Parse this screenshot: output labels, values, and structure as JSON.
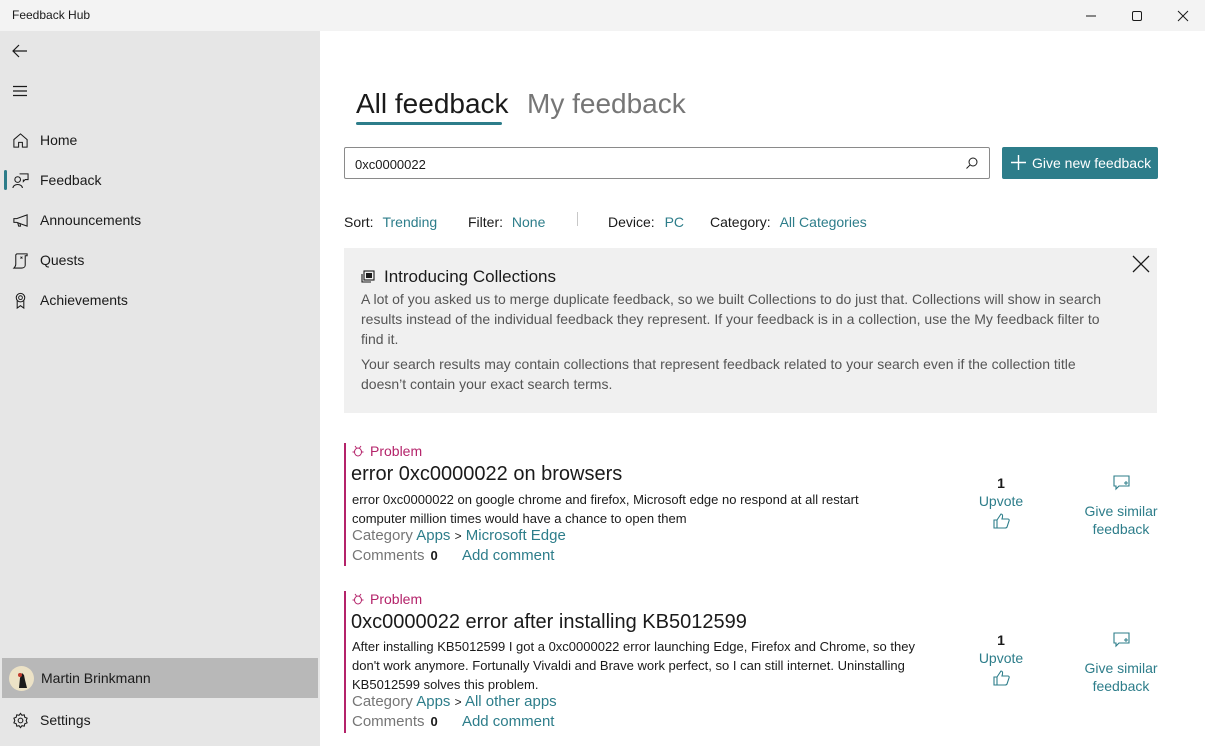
{
  "window": {
    "title": "Feedback Hub",
    "controls": [
      "minimize",
      "maximize",
      "close"
    ]
  },
  "sidebar": {
    "back_icon": "back-arrow-icon",
    "menu_icon": "hamburger-icon",
    "items": [
      {
        "label": "Home",
        "icon": "home-icon",
        "selected": false
      },
      {
        "label": "Feedback",
        "icon": "feedback-icon",
        "selected": true
      },
      {
        "label": "Announcements",
        "icon": "megaphone-icon",
        "selected": false
      },
      {
        "label": "Quests",
        "icon": "quest-scroll-icon",
        "selected": false
      },
      {
        "label": "Achievements",
        "icon": "award-ribbon-icon",
        "selected": false
      }
    ],
    "profile": {
      "name": "Martin Brinkmann"
    },
    "settings": {
      "label": "Settings",
      "icon": "gear-icon"
    }
  },
  "main": {
    "tabs": [
      {
        "label": "All feedback",
        "active": true
      },
      {
        "label": "My feedback",
        "active": false
      }
    ],
    "search": {
      "value": "0xc0000022",
      "placeholder": ""
    },
    "give_button": {
      "label": "Give new feedback"
    },
    "filters": {
      "sort": {
        "label": "Sort:",
        "value": "Trending"
      },
      "filter": {
        "label": "Filter:",
        "value": "None"
      },
      "device": {
        "label": "Device:",
        "value": "PC"
      },
      "category": {
        "label": "Category:",
        "value": "All Categories"
      }
    },
    "banner": {
      "title": "Introducing Collections",
      "paragraph1": "A lot of you asked us to merge duplicate feedback, so we built Collections to do just that. Collections will show in search results instead of the individual feedback they represent. If your feedback is in a collection, use the My feedback filter to find it.",
      "paragraph2": "Your search results may contain collections that represent feedback related to your search even if the collection title doesn’t contain your exact search terms."
    },
    "feedback_items": [
      {
        "type": "Problem",
        "title": "error 0xc0000022 on browsers",
        "body": "error 0xc0000022 on google chrome and firefox, Microsoft edge no respond at all restart computer million times would have a chance to open them",
        "category_label": "Category",
        "category": "Apps",
        "separator": ">",
        "subcategory": "Microsoft Edge",
        "comments_label": "Comments",
        "comments": "0",
        "add_comment": "Add comment",
        "upvotes": "1",
        "upvote_label": "Upvote",
        "similar_label": "Give similar feedback"
      },
      {
        "type": "Problem",
        "title": "0xc0000022 error after installing KB5012599",
        "body": "After installing KB5012599 I got a 0xc0000022 error launching Edge, Firefox and Chrome, so they don't work anymore. Fortunally Vivaldi and Brave work perfect, so I can still internet. Uninstalling KB5012599 solves this problem.",
        "category_label": "Category",
        "category": "Apps",
        "separator": ">",
        "subcategory": "All other apps",
        "comments_label": "Comments",
        "comments": "0",
        "add_comment": "Add comment",
        "upvotes": "1",
        "upvote_label": "Upvote",
        "similar_label": "Give similar feedback"
      }
    ]
  },
  "colors": {
    "accent": "#2d7d8a",
    "problem": "#b4236a",
    "sidebar_bg": "#e6e6e6",
    "profile_bg": "#b8b8b8"
  }
}
